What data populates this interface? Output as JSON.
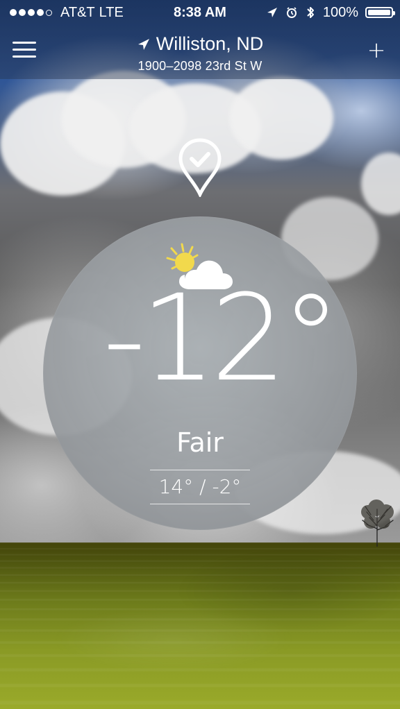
{
  "status_bar": {
    "carrier": "AT&T",
    "network": "LTE",
    "time": "8:38 AM",
    "battery_percent": "100%"
  },
  "header": {
    "menu_icon": "hamburger-menu-icon",
    "location_icon": "location-arrow-icon",
    "city": "Williston, ND",
    "address": "1900–2098 23rd St W",
    "add_icon": "plus-icon"
  },
  "main": {
    "pin_icon": "location-pin-check-icon",
    "weather_icon": "partly-sunny-icon",
    "temperature": "-12°",
    "condition": "Fair",
    "hi_lo": "14° / -2°"
  },
  "colors": {
    "text": "#ffffff",
    "circle_fill": "#9da2a6",
    "sun": "#f2d94c",
    "sky": "#2d5598",
    "field": "#7d8d20"
  }
}
